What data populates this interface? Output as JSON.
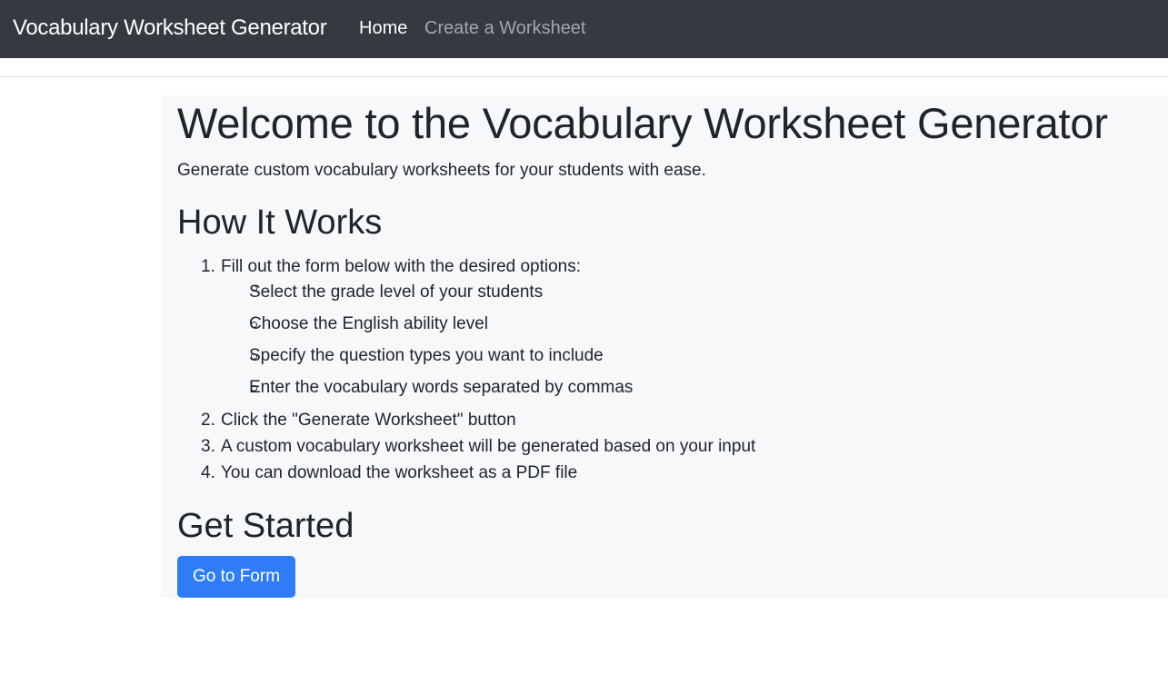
{
  "navbar": {
    "brand": "Vocabulary Worksheet Generator",
    "links": [
      {
        "label": "Home",
        "active": true
      },
      {
        "label": "Create a Worksheet",
        "active": false
      }
    ]
  },
  "main": {
    "title": "Welcome to the Vocabulary Worksheet Generator",
    "lead": "Generate custom vocabulary worksheets for your students with ease.",
    "how_heading": "How It Works",
    "steps": [
      {
        "number": "1.",
        "text": "Fill out the form below with the desired options:",
        "substeps": [
          "Select the grade level of your students",
          "Choose the English ability level",
          "Specify the question types you want to include",
          "Enter the vocabulary words separated by commas"
        ]
      },
      {
        "number": "2.",
        "text": "Click the \"Generate Worksheet\" button"
      },
      {
        "number": "3.",
        "text": "A custom vocabulary worksheet will be generated based on your input"
      },
      {
        "number": "4.",
        "text": "You can download the worksheet as a PDF file"
      }
    ],
    "start_heading": "Get Started",
    "cta_button": "Go to Form"
  },
  "colors": {
    "navbar_bg": "#343a40",
    "jumbotron_bg": "#f7f8fa",
    "primary": "#2f7cf6",
    "text": "#212529"
  }
}
